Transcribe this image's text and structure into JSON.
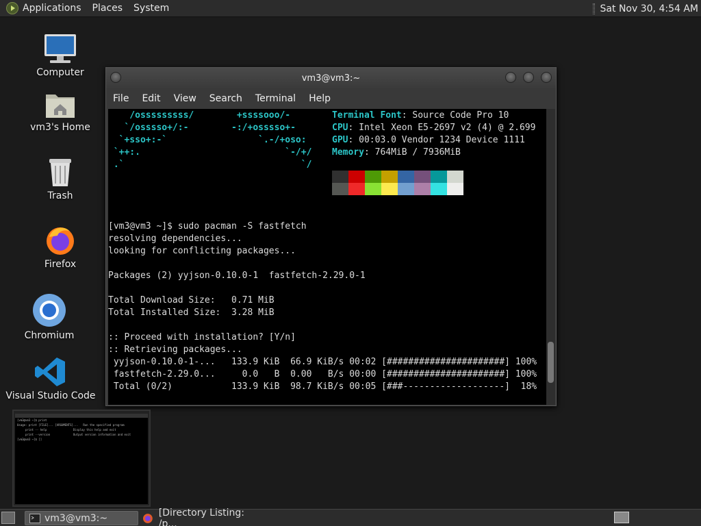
{
  "topbar": {
    "menus": [
      "Applications",
      "Places",
      "System"
    ],
    "clock": "Sat Nov 30,  4:54 AM"
  },
  "desktop": {
    "icons": [
      "Computer",
      "vm3's Home",
      "Trash",
      "Firefox",
      "Chromium",
      "Visual Studio Code"
    ]
  },
  "window": {
    "title": "vm3@vm3:~",
    "menu": [
      "File",
      "Edit",
      "View",
      "Search",
      "Terminal",
      "Help"
    ],
    "logo_lines": [
      "    /osssssssss/        +ssssooo/-",
      "   `/osssso+/:-        -:/+osssso+-",
      "  `+sso+:-`                 `.-/+oso:",
      " `++:.                           `-/+/",
      " .`                                 `/"
    ],
    "info": [
      {
        "label": "Terminal Font",
        "value": ": Source Code Pro 10"
      },
      {
        "label": "CPU",
        "value": ": Intel Xeon E5-2697 v2 (4) @ 2.699"
      },
      {
        "label": "GPU",
        "value": ": 00:03.0 Vendor 1234 Device 1111"
      },
      {
        "label": "Memory",
        "value": ": 764MiB / 7936MiB"
      }
    ],
    "palette": [
      "#303030",
      "#cc0000",
      "#4e9a06",
      "#c4a000",
      "#3465a4",
      "#75507b",
      "#06989a",
      "#d3d7cf",
      "#555753",
      "#ef2929",
      "#8ae234",
      "#fce94f",
      "#729fcf",
      "#ad7fa8",
      "#34e2e2",
      "#eeeeec"
    ],
    "lines": [
      "[vm3@vm3 ~]$ sudo pacman -S fastfetch",
      "resolving dependencies...",
      "looking for conflicting packages...",
      "",
      "Packages (2) yyjson-0.10.0-1  fastfetch-2.29.0-1",
      "",
      "Total Download Size:   0.71 MiB",
      "Total Installed Size:  3.28 MiB",
      "",
      ":: Proceed with installation? [Y/n]",
      ":: Retrieving packages...",
      " yyjson-0.10.0-1-...   133.9 KiB  66.9 KiB/s 00:02 [######################] 100%",
      " fastfetch-2.29.0...     0.0   B  0.00   B/s 00:00 [######################] 100%",
      " Total (0/2)           133.9 KiB  98.7 KiB/s 00:05 [###-------------------]  18%"
    ]
  },
  "mini": {
    "lines": [
      "[vm3@vm3 ~]$ print",
      "Usage: print [FILE]... [ARGUMENTS]...   Run the specified program",
      "     print -- help                Display this help and exit",
      "     print --version              Output version information and exit",
      "[vm3@vm3 ~]$ []"
    ]
  },
  "taskbar": {
    "items": [
      "vm3@vm3:~",
      "[Directory Listing: /p..."
    ]
  }
}
